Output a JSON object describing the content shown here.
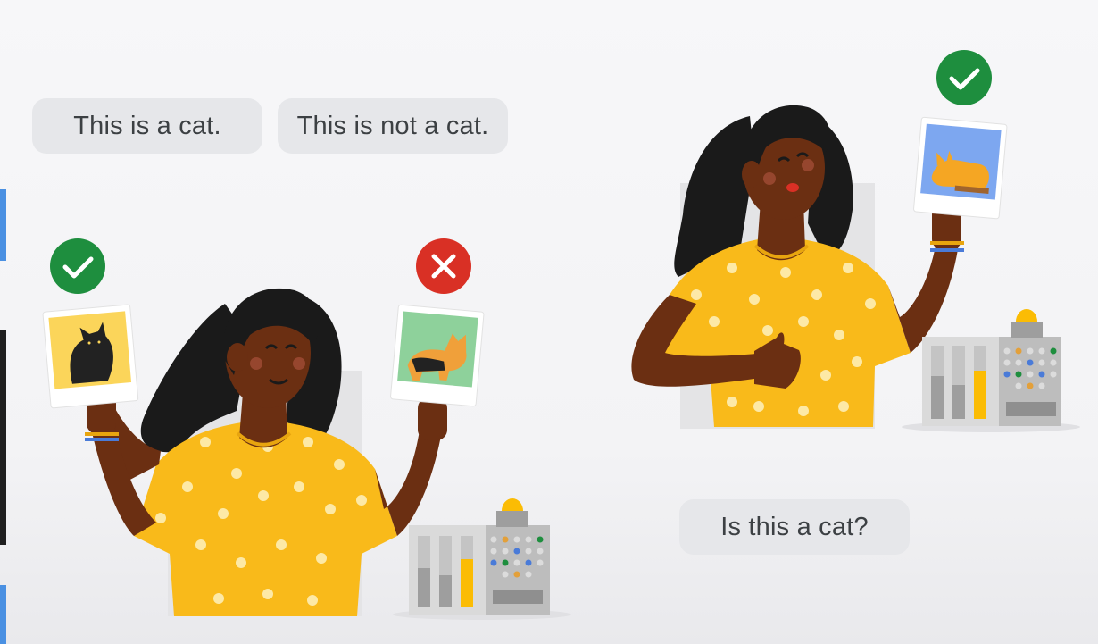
{
  "labels": {
    "positive": "This is a cat.",
    "negative": "This is not a cat.",
    "question": "Is this a cat?"
  },
  "icons": {
    "correct": "checkmark-icon",
    "incorrect": "x-mark-icon"
  },
  "colors": {
    "green": "#1e8e3e",
    "red": "#d93025",
    "shirt": "#f9ba1a",
    "skin": "#6b2f12",
    "hair": "#1a1a1a",
    "machine_gray": "#bdbdbd",
    "machine_yellow": "#fbbc04"
  }
}
